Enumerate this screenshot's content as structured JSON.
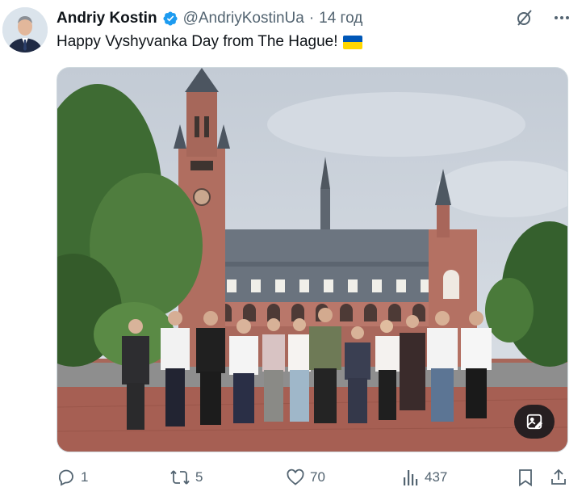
{
  "author": {
    "name": "Andriy Kostin",
    "handle": "@AndriyKostinUa",
    "separator": "·",
    "time": "14 год",
    "verified_color": "#1d9bf0"
  },
  "tweet": {
    "text": "Happy Vyshyvanka Day from The Hague!",
    "emoji": "ukraine-flag",
    "flag_colors": [
      "#0057b7",
      "#ffd700"
    ]
  },
  "header_icons": [
    "grok-icon",
    "more-icon"
  ],
  "media": {
    "badge_icon": "image-edit-icon"
  },
  "actions": {
    "replies": "1",
    "reposts": "5",
    "likes": "70",
    "views": "437"
  },
  "colors": {
    "text": "#0f1419",
    "secondary": "#536471",
    "accent": "#1d9bf0"
  }
}
